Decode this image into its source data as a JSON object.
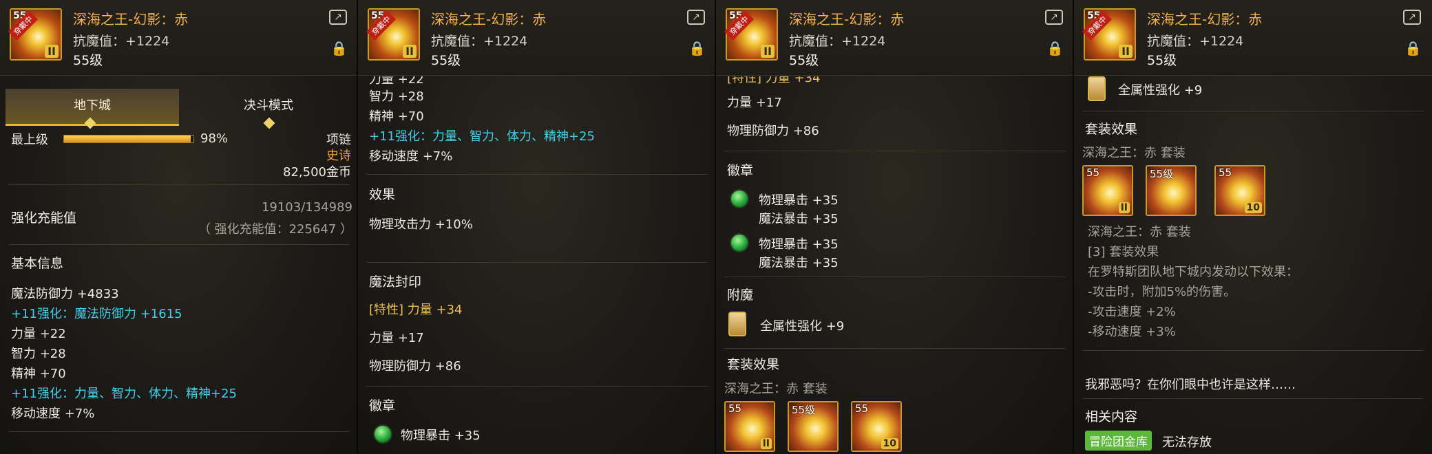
{
  "header": {
    "title": "深海之王-幻影：赤",
    "stat": "抗魔值：+1224",
    "level": "55级",
    "icon_level": "55",
    "icon_tag": "穿戴中",
    "icon_mark": "II"
  },
  "p1": {
    "tab_dungeon": "地下城",
    "tab_duel": "决斗模式",
    "grade": "最上级",
    "grade_percent": "98%",
    "grade_value": 0.98,
    "slot": "项链",
    "rarity": "史诗",
    "price": "82,500金币",
    "charge_label": "强化充能值",
    "charge_value": "19103/134989",
    "charge_total": "（ 强化充能值：225647 ）",
    "basic_header": "基本信息",
    "lines": [
      "魔法防御力 +4833",
      "+11强化：魔法防御力 +1615",
      "力量 +22",
      "智力 +28",
      "精神 +70",
      "+11强化：力量、智力、体力、精神+25",
      "移动速度 +7%"
    ]
  },
  "p2": {
    "top_cut": "力量 +22",
    "lines": [
      "智力 +28",
      "精神 +70",
      "+11强化：力量、智力、体力、精神+25",
      "移动速度 +7%"
    ],
    "effect_header": "效果",
    "effect_line": "物理攻击力 +10%",
    "seal_header": "魔法封印",
    "seal_trait": "[特性] 力量 +34",
    "seal_l1": "力量 +17",
    "seal_l2": "物理防御力 +86",
    "emblem_header": "徽章",
    "emblem_l1": "物理暴击 +35"
  },
  "p3": {
    "top_cut": "[特性] 力量 +34",
    "l1": "力量 +17",
    "l2": "物理防御力 +86",
    "emblem_header": "徽章",
    "e1a": "物理暴击 +35",
    "e1b": "魔法暴击 +35",
    "e2a": "物理暴击 +35",
    "e2b": "魔法暴击 +35",
    "enchant_header": "附魔",
    "enchant_line": "全属性强化 +9",
    "set_header": "套装效果",
    "set_name": "深海之王：赤 套装",
    "set_icons": [
      {
        "lvl": "55",
        "mark": "II"
      },
      {
        "lvl": "55级",
        "mark": ""
      },
      {
        "lvl": "55",
        "mark": "10"
      }
    ]
  },
  "p4": {
    "enchant_line": "全属性强化 +9",
    "set_header": "套装效果",
    "set_name": "深海之王：赤 套装",
    "set_icons": [
      {
        "lvl": "55",
        "mark": "II"
      },
      {
        "lvl": "55级",
        "mark": ""
      },
      {
        "lvl": "55",
        "mark": "10"
      }
    ],
    "set_title": "深海之王：赤 套装",
    "set_bonus": "[3] 套装效果",
    "set_desc": [
      "在罗特斯团队地下城内发动以下效果：",
      "-攻击时，附加5%的伤害。",
      "-攻击速度 +2%",
      "-移动速度 +3%"
    ],
    "flavor": "我邪恶吗？在你们眼中也许是这样……",
    "related_header": "相关内容",
    "badge": "冒险团金库",
    "badge_note": "无法存放"
  }
}
